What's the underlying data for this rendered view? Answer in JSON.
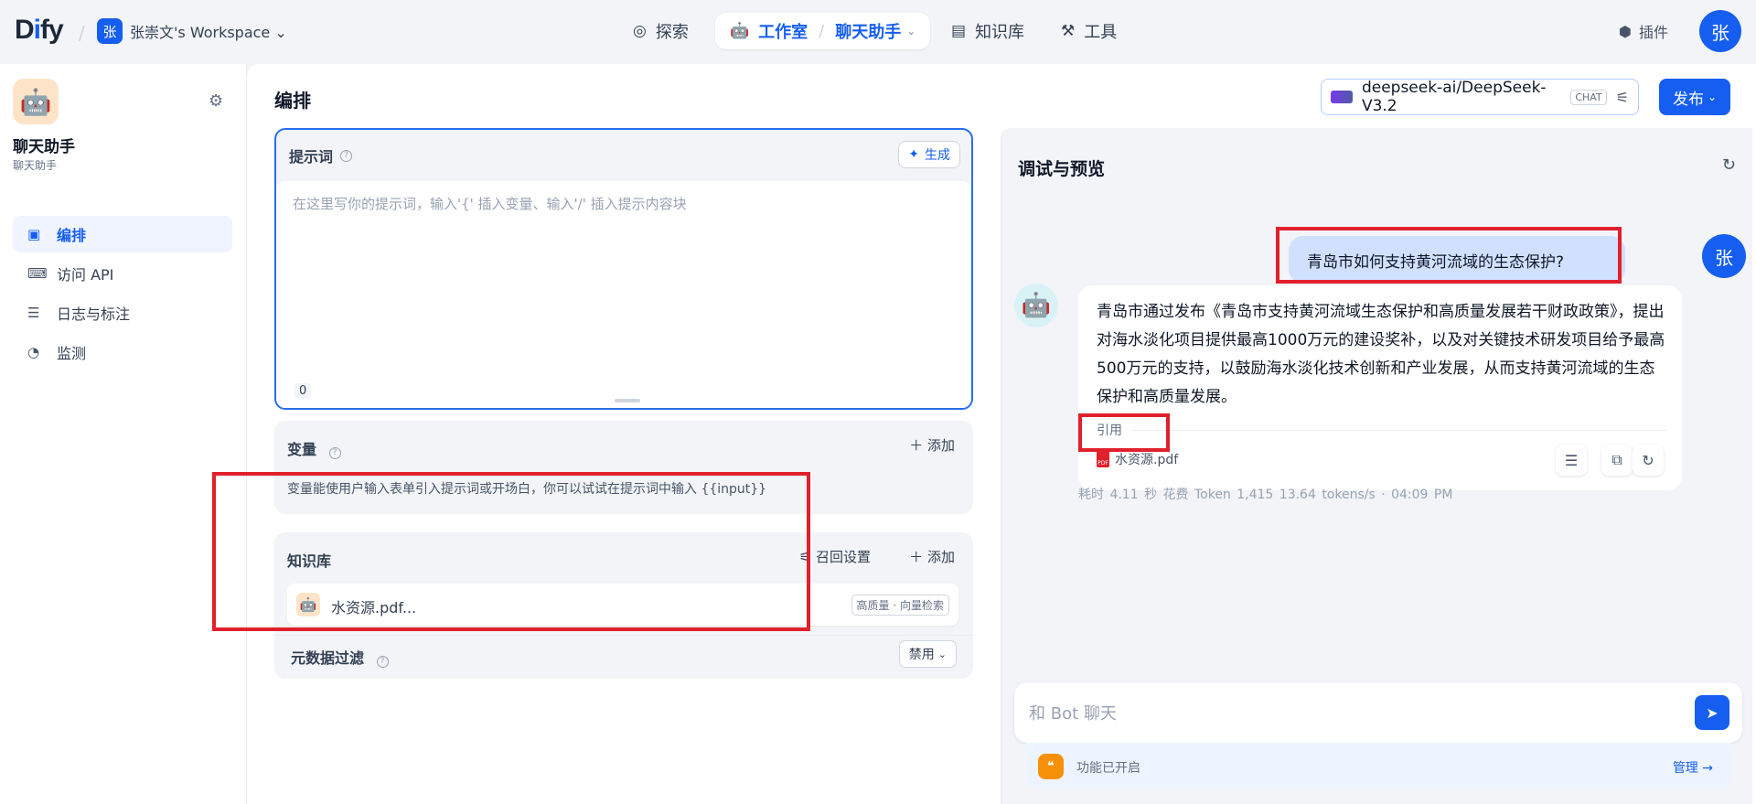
{
  "brand": {
    "logo": "Dify"
  },
  "workspace": {
    "badge": "张",
    "name": "张崇文's Workspace ⌄"
  },
  "nav": {
    "explore": "探索",
    "studio": "工作室",
    "app": "聊天助手",
    "knowledge": "知识库",
    "tools": "工具",
    "plugins": "插件",
    "user_avatar": "张"
  },
  "sidebar": {
    "app_name": "聊天助手",
    "app_type": "聊天助手",
    "items": [
      {
        "label": "编排",
        "icon": "layout-icon",
        "active": true
      },
      {
        "label": "访问 API",
        "icon": "terminal-icon",
        "active": false
      },
      {
        "label": "日志与标注",
        "icon": "log-icon",
        "active": false
      },
      {
        "label": "监测",
        "icon": "monitor-icon",
        "active": false
      }
    ]
  },
  "main": {
    "title": "编排",
    "model": {
      "name": "deepseek-ai/DeepSeek-V3.2",
      "tag": "CHAT"
    },
    "publish": "发布"
  },
  "prompt": {
    "title": "提示词",
    "generate": "生成",
    "placeholder": "在这里写你的提示词，输入'{' 插入变量、输入'/' 插入提示内容块",
    "count": "0"
  },
  "variables": {
    "title": "变量",
    "add": "添加",
    "description": "变量能使用户输入表单引入提示词或开场白，你可以试试在提示词中输入 {{input}}"
  },
  "knowledge": {
    "title": "知识库",
    "recall_settings": "召回设置",
    "add": "添加",
    "item": {
      "name": "水资源.pdf...",
      "tag": "高质量 · 向量检索"
    },
    "metadata_filter": "元数据过滤",
    "metadata_value": "禁用"
  },
  "debug": {
    "title": "调试与预览",
    "user_message": "青岛市如何支持黄河流域的生态保护?",
    "user_avatar": "张",
    "bot_message": "青岛市通过发布《青岛市支持黄河流域生态保护和高质量发展若干财政政策》，提出对海水淡化项目提供最高1000万元的建设奖补，以及对关键技术研发项目给予最高500万元的支持，以鼓励海水淡化技术创新和产业发展，从而支持黄河流域的生态保护和高质量发展。",
    "citation_label": "引用",
    "citation_file": "水资源.pdf",
    "stats": "耗时 4.11 秒   花费 Token 1,415   13.64 tokens/s   · 04:09 PM",
    "input_placeholder": "和 Bot 聊天",
    "features_enabled": "功能已开启",
    "manage": "管理 →"
  },
  "colors": {
    "accent": "#155eef",
    "highlight": "#e0202b"
  }
}
